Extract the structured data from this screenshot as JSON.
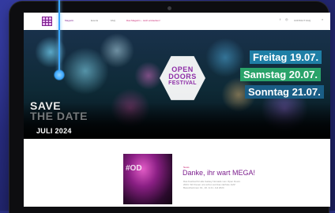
{
  "nav": {
    "links": [
      "Magazin",
      "Events",
      "FAQ",
      "Das Magazin – Jetzt entdecken!"
    ],
    "contact_label": "CONTACT FAQ"
  },
  "hero": {
    "logo": {
      "line1": "OPEN",
      "line2": "DOORS",
      "line3": "FESTIVAL"
    },
    "dates": [
      {
        "label": "Freitag 19.07.",
        "color": "#1f7fa6"
      },
      {
        "label": "Samstag 20.07.",
        "color": "#2aa36a"
      },
      {
        "label": "Sonntag 21.07.",
        "color": "#1a5e86"
      }
    ],
    "save_the_date": {
      "line1": "SAVE",
      "line2": "THE DATE"
    },
    "month": "JULI 2024"
  },
  "post": {
    "category": "News",
    "title": "Danke, ihr wart MEGA!",
    "excerpt": "Das Festival für alle Galaxy Nomads vom Open Doors 2024. Wir freuen uns schon auf das nächste Jahr! Besucherinnen 19., 20. & 21. Juli 2024",
    "thumb_text": "#OD"
  },
  "colors": {
    "brand_purple": "#7d1f8e",
    "accent_magenta": "#c81e6e",
    "background": "#2a2f86"
  }
}
